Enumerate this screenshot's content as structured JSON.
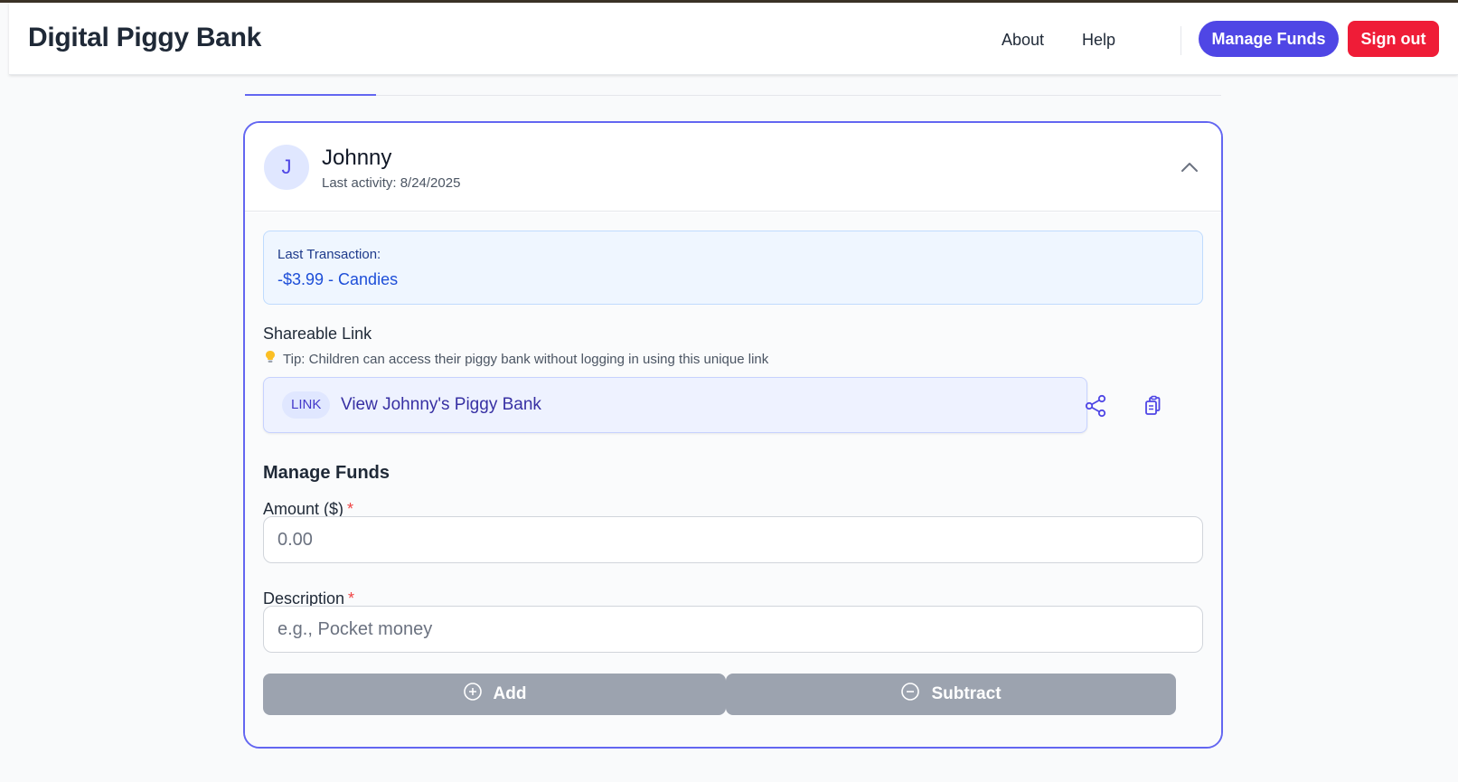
{
  "header": {
    "brand": "Digital Piggy Bank",
    "nav": {
      "about": "About",
      "help": "Help"
    },
    "manage_funds_label": "Manage Funds",
    "sign_out_label": "Sign out"
  },
  "child": {
    "initial": "J",
    "name": "Johnny",
    "last_activity": "Last activity: 8/24/2025"
  },
  "last_transaction": {
    "label": "Last Transaction:",
    "value": "-$3.99 - Candies"
  },
  "shareable_link": {
    "title": "Shareable Link",
    "tip": "Tip: Children can access their piggy bank without logging in using this unique link",
    "badge": "LINK",
    "link_text": "View Johnny's Piggy Bank"
  },
  "manage_funds": {
    "title": "Manage Funds",
    "amount_label": "Amount ($)",
    "amount_placeholder": "0.00",
    "description_label": "Description",
    "description_placeholder": "e.g., Pocket money",
    "required_mark": "*",
    "add_label": "Add",
    "subtract_label": "Subtract"
  },
  "icons": {
    "tip": "lightbulb-icon",
    "share": "share-icon",
    "copy": "copy-icon",
    "collapse": "chevron-up-icon",
    "add": "plus-circle-icon",
    "subtract": "minus-circle-icon"
  },
  "colors": {
    "accent": "#4f46e5",
    "danger": "#ef1c37",
    "disabled_button": "#9ca3af"
  }
}
